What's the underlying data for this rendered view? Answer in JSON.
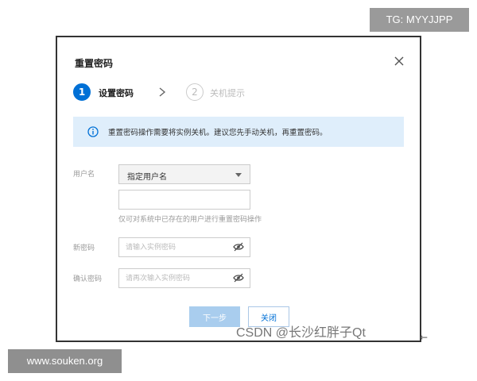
{
  "overlay": {
    "top_tag": "TG: MYYJJPP",
    "bottom_tag": "www.souken.org",
    "watermark": "CSDN @长沙红胖子Qt"
  },
  "dialog": {
    "title": "重置密码",
    "close_icon": "close-icon",
    "steps": [
      {
        "number": "1",
        "label": "设置密码",
        "state": "active"
      },
      {
        "number": "2",
        "label": "关机提示",
        "state": "inactive"
      }
    ],
    "alert": {
      "icon": "info-icon",
      "text": "重置密码操作需要将实例关机。建议您先手动关机，再重置密码。"
    },
    "username": {
      "label": "用户名",
      "select_value": "指定用户名",
      "input_value": "",
      "hint": "仅可对系统中已存在的用户进行重置密码操作"
    },
    "new_password": {
      "label": "新密码",
      "placeholder": "请输入实例密码"
    },
    "confirm_password": {
      "label": "确认密码",
      "placeholder": "请再次输入实例密码"
    },
    "buttons": {
      "next": "下一步",
      "close": "关闭"
    }
  },
  "colors": {
    "primary": "#0070d6",
    "alert_bg": "#dfeefb",
    "disabled_btn": "#a9cdee"
  }
}
